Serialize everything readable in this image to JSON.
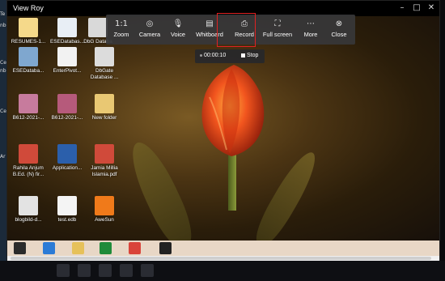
{
  "window": {
    "title": "View Roy"
  },
  "host_labels": [
    "Te",
    "nb",
    "Ce",
    "nb",
    "Ce",
    "Ar"
  ],
  "toolbar": {
    "items": [
      {
        "label": "Zoom",
        "icon": "1:1"
      },
      {
        "label": "Camera",
        "icon": "camera-icon"
      },
      {
        "label": "Voice",
        "icon": "mic-icon"
      },
      {
        "label": "Whitboard",
        "icon": "whiteboard-icon"
      },
      {
        "label": "Record",
        "icon": "record-icon"
      },
      {
        "label": "Full screen",
        "icon": "fullscreen-icon"
      },
      {
        "label": "More",
        "icon": "more-icon"
      },
      {
        "label": "Close",
        "icon": "close-icon"
      }
    ]
  },
  "zoom_glyph": "1:1",
  "recording": {
    "time": "00:00:10",
    "stop_label": "Stop"
  },
  "desktop_icons": [
    {
      "label": "RESUMES-1...",
      "color": "#f5d98a"
    },
    {
      "label": "ESEDatabas...",
      "color": "#e8eef5"
    },
    {
      "label": "DbG Databa",
      "color": "#d9d9d9"
    },
    {
      "label": "ESEDataba...",
      "color": "#7fa7cf"
    },
    {
      "label": "EnterPivot...",
      "color": "#f2f2f2"
    },
    {
      "label": "DbGate Database ...",
      "color": "#dcdcdc"
    },
    {
      "label": "B612-2021-...",
      "color": "#c77b9d"
    },
    {
      "label": "B612-2021-...",
      "color": "#b65a7b"
    },
    {
      "label": "New folder",
      "color": "#e9c873"
    },
    {
      "label": "Rahila Anjum B.Ed. (N) fir...",
      "color": "#d04a3a"
    },
    {
      "label": "Application...",
      "color": "#2b5fab"
    },
    {
      "label": "Jamia Millia Islamia.pdf",
      "color": "#d04a3a"
    },
    {
      "label": "blogbild-d...",
      "color": "#e3e3e3"
    },
    {
      "label": "test.edb",
      "color": "#f4f4f4"
    },
    {
      "label": "AweSun",
      "color": "#f07a1a"
    }
  ],
  "colors": {
    "record_highlight": "#e02222",
    "toolbar_bg": "#37373a",
    "taskbar_bg": "#e8d7c6"
  }
}
